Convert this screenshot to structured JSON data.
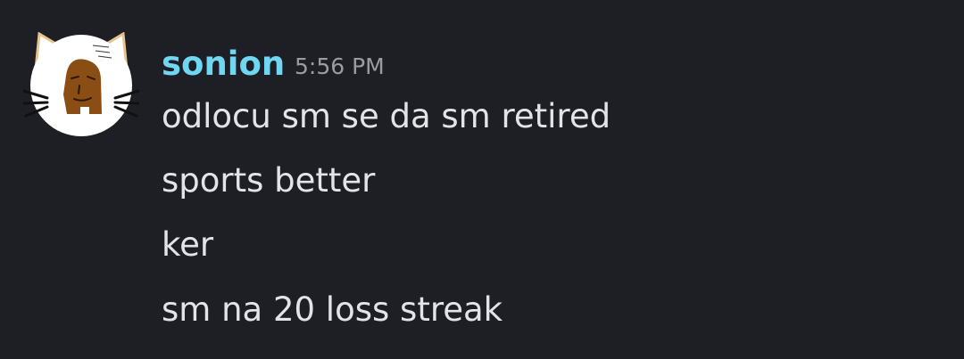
{
  "message": {
    "author": {
      "username": "sonion",
      "username_color": "#6fd7f2",
      "avatar": "white-cat-ear-avatar-with-face"
    },
    "timestamp": "5:56 PM",
    "lines": [
      "odlocu sm se da sm retired",
      "sports better",
      "ker",
      "sm na 20 loss streak"
    ]
  },
  "theme": {
    "background": "#1e1f24",
    "text": "#e3e4e8",
    "muted": "#9a9ca3"
  }
}
